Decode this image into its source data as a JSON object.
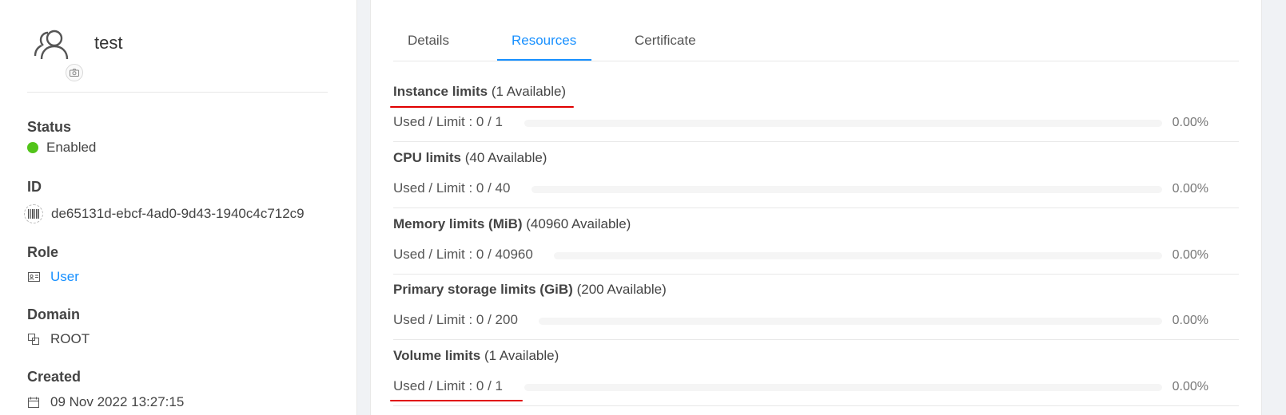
{
  "user": {
    "name": "test",
    "status_label": "Status",
    "status_value": "Enabled",
    "status_color": "#52c41a",
    "id_label": "ID",
    "id_value": "de65131d-ebcf-4ad0-9d43-1940c4c712c9",
    "role_label": "Role",
    "role_value": "User",
    "domain_label": "Domain",
    "domain_value": "ROOT",
    "created_label": "Created",
    "created_value": "09 Nov 2022 13:27:15"
  },
  "tabs": [
    {
      "label": "Details",
      "active": false
    },
    {
      "label": "Resources",
      "active": true
    },
    {
      "label": "Certificate",
      "active": false
    }
  ],
  "resources": [
    {
      "title": "Instance limits",
      "available": "(1 Available)",
      "used_text": "Used / Limit : 0 / 1",
      "percent_text": "0.00%",
      "fraction": 0
    },
    {
      "title": "CPU limits",
      "available": "(40 Available)",
      "used_text": "Used / Limit : 0 / 40",
      "percent_text": "0.00%",
      "fraction": 0
    },
    {
      "title": "Memory limits (MiB)",
      "available": "(40960 Available)",
      "used_text": "Used / Limit : 0 / 40960",
      "percent_text": "0.00%",
      "fraction": 0
    },
    {
      "title": "Primary storage limits (GiB)",
      "available": "(200 Available)",
      "used_text": "Used / Limit : 0 / 200",
      "percent_text": "0.00%",
      "fraction": 0
    },
    {
      "title": "Volume limits",
      "available": "(1 Available)",
      "used_text": "Used / Limit : 0 / 1",
      "percent_text": "0.00%",
      "fraction": 0
    }
  ],
  "colors": {
    "accent": "#1890ff",
    "annotation": "#e00000"
  }
}
